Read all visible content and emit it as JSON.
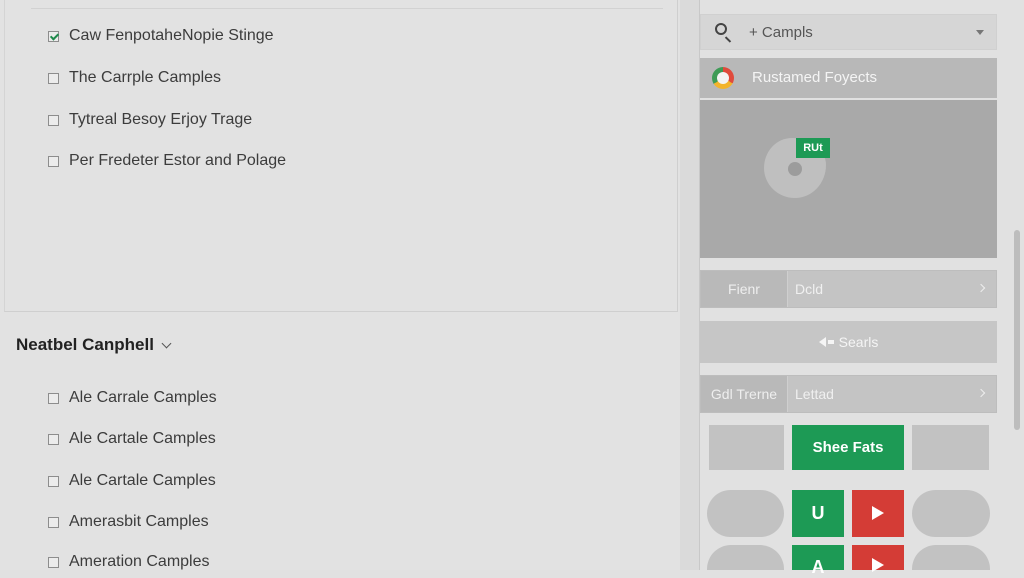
{
  "top_list": {
    "items": [
      {
        "label": "Caw FenpotaheNopie Stinge",
        "checked": true
      },
      {
        "label": "The Carrple Camples",
        "checked": false
      },
      {
        "label": "Tytreal Besoy Erjoy Trage",
        "checked": false
      },
      {
        "label": "Per Fredeter Estor and Polage",
        "checked": false
      }
    ]
  },
  "section": {
    "title": "Neatbel Canphell",
    "items": [
      {
        "label": "Ale Carrale Camples",
        "checked": false
      },
      {
        "label": "Ale Cartale Camples",
        "checked": false
      },
      {
        "label": "Ale Cartale Camples",
        "checked": false
      },
      {
        "label": "Amerasbit Camples",
        "checked": false
      },
      {
        "label": "Ameration Camples",
        "checked": false
      }
    ]
  },
  "sidebar": {
    "search_value": "+ Campls",
    "project_title": "Rustamed Foyects",
    "preview_badge": "RUt",
    "field1": {
      "label": "Fienr",
      "value": "Dcld"
    },
    "search_button": "Searls",
    "field2": {
      "label": "Gdl Trerne",
      "value": "Lettad"
    },
    "featured_button": "Shee Fats",
    "u_button": "U",
    "a_button": "A"
  },
  "colors": {
    "accent_green": "#1d9a55",
    "accent_red": "#d43c36"
  },
  "icons": [
    "search-icon",
    "chevron-down-icon",
    "back-arrow-icon",
    "play-icon",
    "chevron-right-icon"
  ]
}
